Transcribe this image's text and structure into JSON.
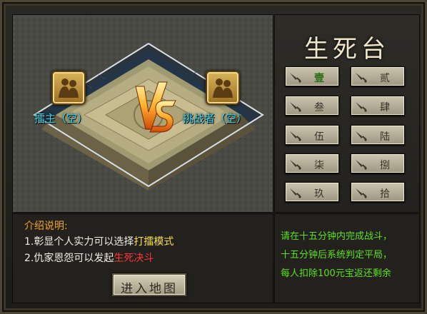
{
  "arena": {
    "host_label": "擂主（空）",
    "challenger_label": "挑战者（空）",
    "vs_text": "VS",
    "host_icon": "warriors-icon",
    "challenger_icon": "warriors-icon"
  },
  "side": {
    "title": "生死台",
    "levels": [
      "壹",
      "贰",
      "叁",
      "肆",
      "伍",
      "陆",
      "柒",
      "捌",
      "玖",
      "拾"
    ],
    "active_index": 0
  },
  "description": {
    "title": "介绍说明:",
    "line1_prefix": "1.彰显个人实力可以选择",
    "line1_highlight": "打擂模式",
    "line2_prefix": "2.仇家恩怨可以发起",
    "line2_highlight": "生死决斗",
    "enter_button": "进入地图"
  },
  "rules": [
    "请在十五分钟内完成战斗，",
    "十五分钟后系统判定平局，",
    "每人扣除100元宝返还剩余"
  ],
  "colors": {
    "name_cyan": "#3fd6ee",
    "highlight_yellow": "#f7e04a",
    "highlight_red": "#ff3737",
    "rules_green": "#5ee01e",
    "title_orange": "#f0a22a"
  }
}
